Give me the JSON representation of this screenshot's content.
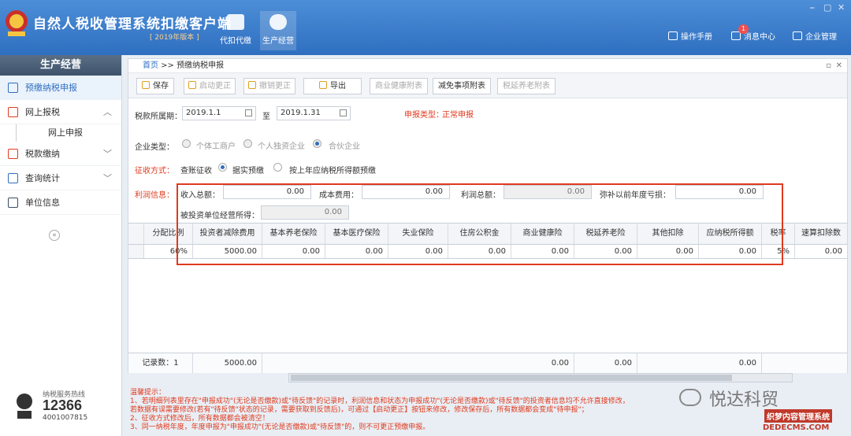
{
  "header": {
    "title": "自然人税收管理系统扣缴客户端",
    "subtitle": "[ 2019年版本 ]",
    "modules": [
      {
        "label": "代扣代缴"
      },
      {
        "label": "生产经营"
      }
    ],
    "links": {
      "manual": "操作手册",
      "messages": "消息中心",
      "enterprise": "企业管理",
      "message_count": "1"
    },
    "window_controls": [
      "⎯",
      "▢",
      "✕"
    ]
  },
  "sidebar": {
    "title": "生产经营",
    "items": [
      {
        "label": "预缴纳税申报"
      },
      {
        "label": "网上报税"
      },
      {
        "label": "网上申报"
      },
      {
        "label": "税款缴纳"
      },
      {
        "label": "查询统计"
      },
      {
        "label": "单位信息"
      }
    ],
    "hotline_label": "纳税服务热线",
    "hotline_number": "12366",
    "hotline_number2": "4001007815"
  },
  "breadcrumb": {
    "home": "首页",
    "sep": " >> ",
    "current": "预缴纳税申报"
  },
  "toolbar": {
    "save": "保存",
    "start_correction": "启动更正",
    "cancel_correction": "撤销更正",
    "export": "导出",
    "health_schedule": "商业健康附表",
    "relief_schedule": "减免事项附表",
    "pension_schedule": "税延养老附表"
  },
  "form": {
    "period_label": "税款所属期：",
    "period_from": "2019.1.1",
    "to_label": "至",
    "period_to": "2019.1.31",
    "declare_type_label": "申报类型：",
    "declare_type": "正常申报",
    "enterprise_type_label": "企业类型：",
    "enterprise_types": [
      "个体工商户",
      "个人独资企业",
      "合伙企业"
    ],
    "levy_label": "征收方式：",
    "levy_options": [
      "查账征收",
      "据实预缴",
      "按上年应纳税所得额预缴"
    ],
    "profit_label": "利润信息：",
    "income_label": "收入总额：",
    "income": "0.00",
    "cost_label": "成本费用：",
    "cost": "0.00",
    "profit_total_label": "利润总额：",
    "profit_total": "0.00",
    "loss_label": "弥补以前年度亏损：",
    "loss": "0.00",
    "investee_label": "被投资单位经营所得：",
    "investee": "0.00"
  },
  "table": {
    "headers": [
      "分配比例",
      "投资者减除费用",
      "基本养老保险",
      "基本医疗保险",
      "失业保险",
      "住房公积金",
      "商业健康险",
      "税延养老险",
      "其他扣除",
      "应纳税所得额",
      "税率",
      "速算扣除数"
    ],
    "row": [
      "60%",
      "5000.00",
      "0.00",
      "0.00",
      "0.00",
      "0.00",
      "0.00",
      "0.00",
      "0.00",
      "0.00",
      "5%",
      "0.00"
    ],
    "footer": {
      "count_label": "记录数：1",
      "deduction": "5000.00",
      "health": "0.00",
      "pension": "0.00",
      "taxable": "0.00"
    }
  },
  "tips": {
    "title": "温馨提示：",
    "lines": [
      "1、若明细列表里存在\"申报成功\"(无论是否缴款)或\"待反馈\"的记录时，利润信息和状态为申报成功\"(无论是否缴款)或\"待反馈\"的投资者信息均不允许直接修改，",
      "   若数据有误需要修改(若有\"待反馈\"状态的记录，需要获取到反馈后)，可通过【启动更正】按钮来修改，修改保存后，所有数据都会变成\"待申报\"；",
      "2、征收方式修改后，所有数据都会被清空！",
      "3、同一纳税年度，年度申报为\"申报成功\"(无论是否缴款)或\"待反馈\"的，则不可更正预缴申报。"
    ]
  },
  "watermark": {
    "brand": "悦达科贸",
    "site": "织梦内容管理系统",
    "domain": "DEDECMS.COM"
  }
}
